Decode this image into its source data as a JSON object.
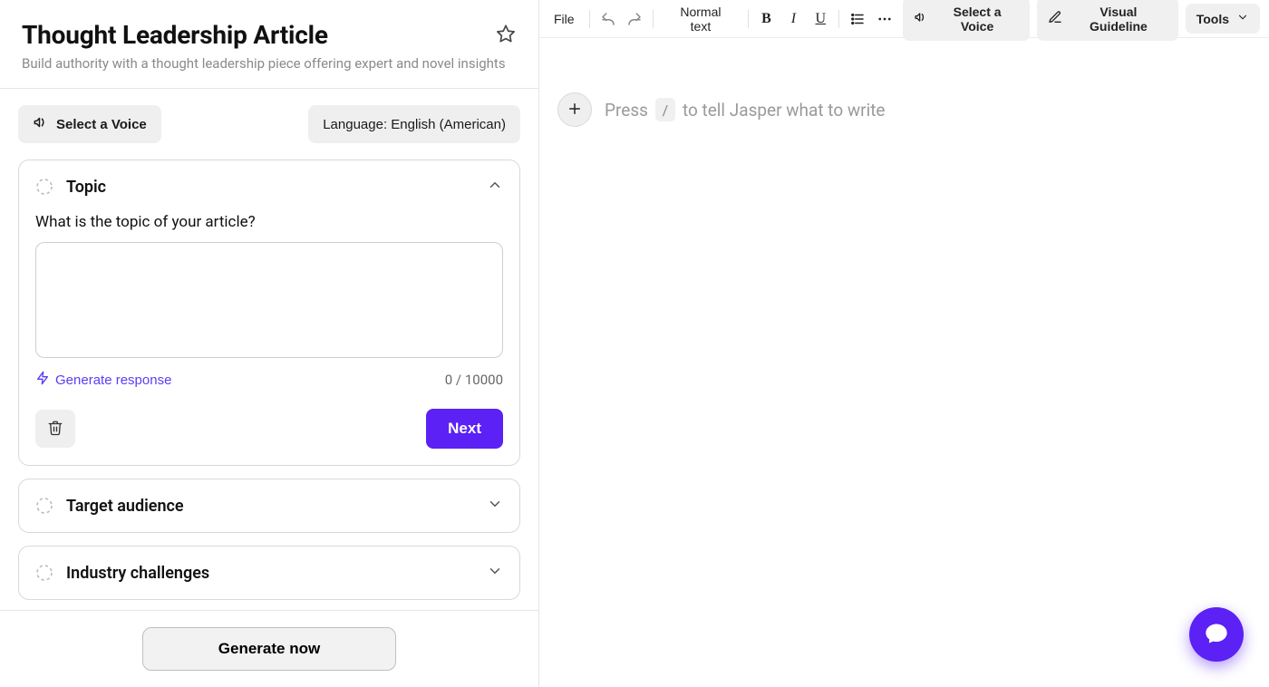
{
  "left": {
    "title": "Thought Leadership Article",
    "subtitle": "Build authority with a thought leadership piece offering expert and novel insights",
    "voice_chip": "Select a Voice",
    "language_chip": "Language: English (American)",
    "topic": {
      "label": "Topic",
      "question": "What is the topic of your article?",
      "value": "",
      "generate_link": "Generate response",
      "counter": "0 / 10000",
      "next": "Next"
    },
    "collapsed": [
      {
        "label": "Target audience"
      },
      {
        "label": "Industry challenges"
      }
    ],
    "generate_now": "Generate now"
  },
  "toolbar": {
    "file": "File",
    "style": "Normal text",
    "voice": "Select a Voice",
    "visual": "Visual Guideline",
    "tools": "Tools"
  },
  "editor": {
    "press": "Press",
    "slash": "/",
    "rest": "to tell Jasper what to write"
  }
}
